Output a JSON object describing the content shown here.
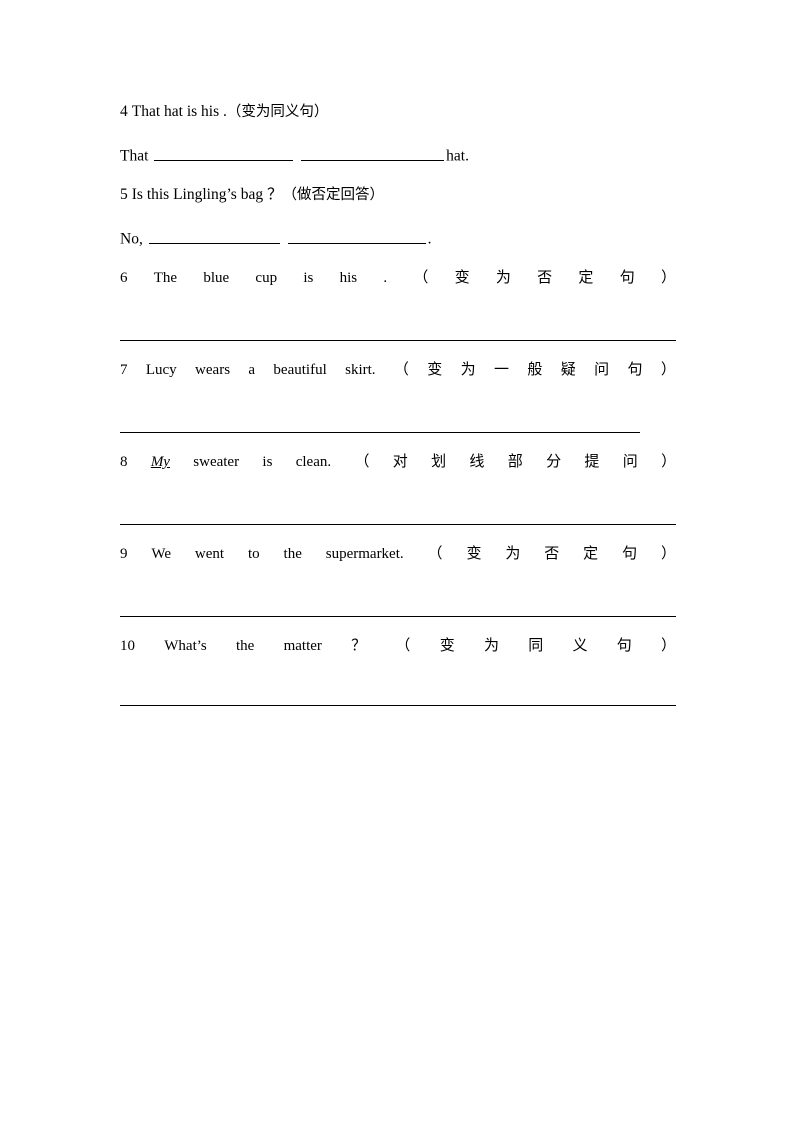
{
  "document": {
    "type": "worksheet",
    "language_mix": "English with Chinese instructions",
    "items_compact": [
      {
        "number": "4",
        "sentence": "That hat is his .",
        "instruction": "（变为同义句）",
        "answer_prefix": "That",
        "answer_suffix": "hat.",
        "blanks": 2
      },
      {
        "number": "5",
        "sentence": "Is this Lingling’s bag ？",
        "instruction": "（做否定回答）",
        "answer_prefix": "No,",
        "answer_suffix": ".",
        "blanks": 2
      }
    ],
    "items_justified": [
      {
        "number": "6",
        "tokens": [
          "The",
          "blue",
          "cup",
          "is",
          "his",
          "."
        ],
        "instruction_tokens": [
          "（",
          "变",
          "为",
          "否",
          "定",
          "句",
          "）"
        ],
        "rule": "full"
      },
      {
        "number": "7",
        "tokens": [
          "Lucy",
          "wears",
          "a",
          "beautiful",
          "skirt."
        ],
        "instruction_tokens": [
          "（",
          "变",
          "为",
          "一",
          "般",
          "疑",
          "问",
          "句",
          "）"
        ],
        "rule": "short"
      },
      {
        "number": "8",
        "tokens": [
          "My",
          "sweater",
          "is",
          "clean."
        ],
        "emphasis_token_index": 0,
        "instruction_tokens": [
          "（",
          "对",
          "划",
          "线",
          "部",
          "分",
          "提",
          "问",
          "）"
        ],
        "rule": "full"
      },
      {
        "number": "9",
        "tokens": [
          "We",
          "went",
          "to",
          "the",
          "supermarket."
        ],
        "instruction_tokens": [
          "（",
          "变",
          "为",
          "否",
          "定",
          "句",
          "）"
        ],
        "rule": "full"
      },
      {
        "number": "10",
        "tokens": [
          "What’s",
          "the",
          "matter",
          "？"
        ],
        "instruction_tokens": [
          "（",
          "变",
          "为",
          "同",
          "义",
          "句",
          "）"
        ],
        "rule": "full"
      }
    ]
  }
}
